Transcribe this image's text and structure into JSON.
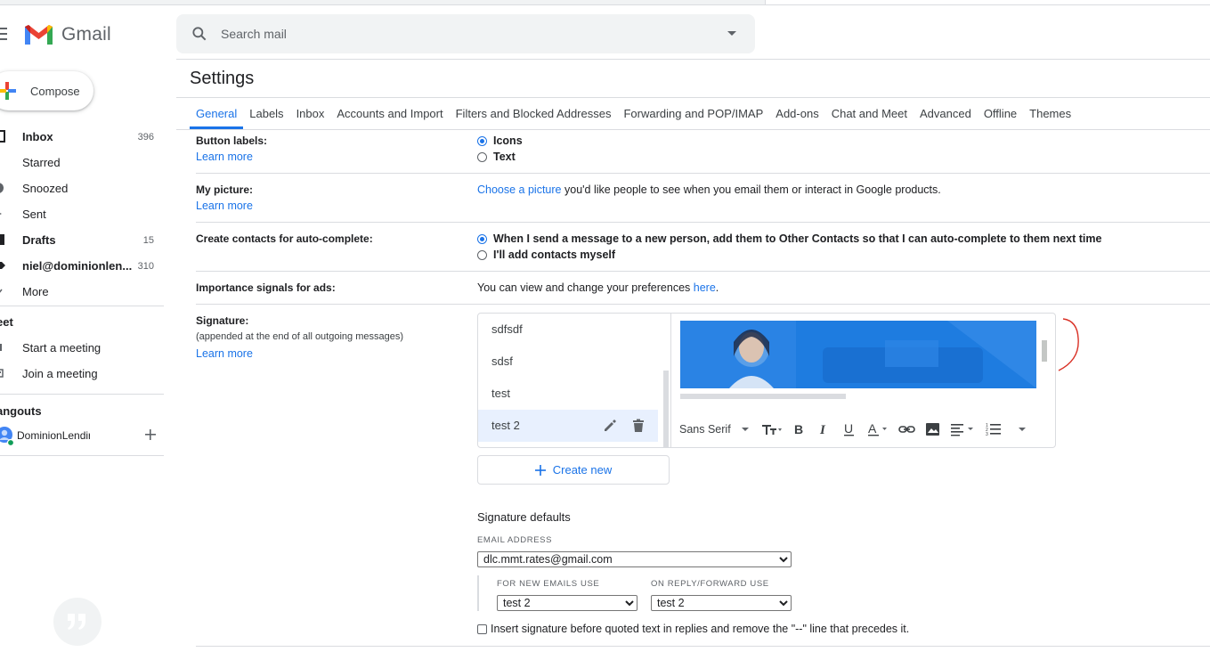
{
  "app": {
    "name": "Gmail"
  },
  "search": {
    "placeholder": "Search mail"
  },
  "compose": {
    "label": "Compose"
  },
  "nav": [
    {
      "label": "Inbox",
      "count": "396",
      "bold": true,
      "icon": "inbox-icon"
    },
    {
      "label": "Starred",
      "count": "",
      "bold": false,
      "icon": "star-icon"
    },
    {
      "label": "Snoozed",
      "count": "",
      "bold": false,
      "icon": "clock-icon"
    },
    {
      "label": "Sent",
      "count": "",
      "bold": false,
      "icon": "send-icon"
    },
    {
      "label": "Drafts",
      "count": "15",
      "bold": true,
      "icon": "draft-icon"
    },
    {
      "label": "niel@dominionlen...",
      "count": "310",
      "bold": true,
      "icon": "label-icon"
    },
    {
      "label": "More",
      "count": "",
      "bold": false,
      "icon": "chevron-down-icon"
    }
  ],
  "meet": {
    "heading": "eet",
    "items": [
      {
        "label": "Start a meeting",
        "icon": "video-icon"
      },
      {
        "label": "Join a meeting",
        "icon": "keyboard-icon"
      }
    ]
  },
  "hangouts": {
    "heading": "angouts",
    "user": "DominionLendir"
  },
  "settings": {
    "title": "Settings",
    "tabs": [
      "General",
      "Labels",
      "Inbox",
      "Accounts and Import",
      "Filters and Blocked Addresses",
      "Forwarding and POP/IMAP",
      "Add-ons",
      "Chat and Meet",
      "Advanced",
      "Offline",
      "Themes"
    ],
    "learn_more": "Learn more",
    "button_labels": {
      "label": "Button labels:",
      "opt1": "Icons",
      "opt2": "Text"
    },
    "my_picture": {
      "label": "My picture:",
      "link": "Choose a picture",
      "text": " you'd like people to see when you email them or interact in Google products."
    },
    "contacts": {
      "label": "Create contacts for auto-complete:",
      "opt1": "When I send a message to a new person, add them to Other Contacts so that I can auto-complete to them next time",
      "opt2": "I'll add contacts myself"
    },
    "ads": {
      "label": "Importance signals for ads:",
      "text": "You can view and change your preferences ",
      "link": "here",
      "end": "."
    },
    "signature": {
      "label": "Signature:",
      "sub": "(appended at the end of all outgoing messages)",
      "items": [
        "sdfsdf",
        "sdsf",
        "test",
        "test 2"
      ],
      "font": "Sans Serif",
      "create_new": "Create new",
      "defaults_title": "Signature defaults",
      "email_caption": "EMAIL ADDRESS",
      "email_value": "dlc.mmt.rates@gmail.com",
      "new_caption": "FOR NEW EMAILS USE",
      "new_value": "test 2",
      "reply_caption": "ON REPLY/FORWARD USE",
      "reply_value": "test 2",
      "insert_text": "Insert signature before quoted text in replies and remove the \"--\" line that precedes it."
    }
  },
  "colors": {
    "accent": "#1a73e8",
    "gmail_red": "#ea4335",
    "annotation": "#d93025"
  }
}
